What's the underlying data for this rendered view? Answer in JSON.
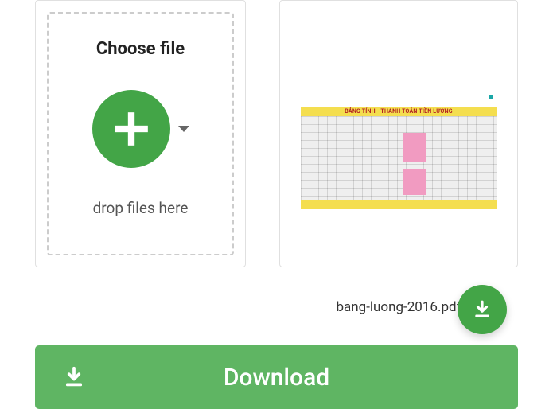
{
  "upload": {
    "choose_label": "Choose file",
    "drop_label": "drop files here"
  },
  "file": {
    "name": "bang-luong-2016.pdf",
    "preview_title": "BẢNG TÍNH - THANH TOÁN TIỀN LƯƠNG"
  },
  "actions": {
    "download_label": "Download"
  },
  "colors": {
    "accent": "#43a547",
    "accent_light": "#5fb563"
  }
}
